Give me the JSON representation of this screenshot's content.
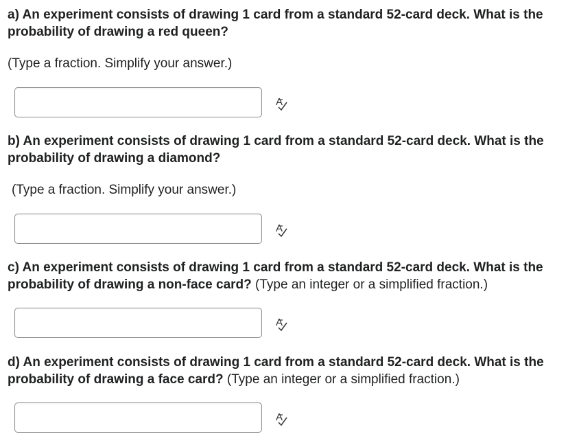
{
  "questions": [
    {
      "prompt_bold": "a) An experiment consists of drawing 1 card from a standard 52-card deck. What is the probability of drawing a red queen?",
      "prompt_inline_hint": "",
      "hint": "(Type a fraction. Simplify your answer.)",
      "answer_value": ""
    },
    {
      "prompt_bold": "b) An experiment consists of drawing 1 card from a standard 52-card deck. What is the probability of drawing a diamond?",
      "prompt_inline_hint": "",
      "hint": "(Type a fraction. Simplify your answer.)",
      "answer_value": ""
    },
    {
      "prompt_bold": "c) An experiment consists of drawing 1 card from a standard 52-card deck. What is the probability of drawing a non-face card?",
      "prompt_inline_hint": " (Type an integer or a simplified fraction.)",
      "hint": "",
      "answer_value": ""
    },
    {
      "prompt_bold": "d) An experiment consists of drawing 1 card from a standard 52-card deck. What is the probability of drawing a face card? ",
      "prompt_inline_hint": " (Type an integer or a simplified fraction.)",
      "hint": "",
      "answer_value": ""
    }
  ],
  "icons": {
    "equation_editor": "math-equation-editor-icon"
  }
}
